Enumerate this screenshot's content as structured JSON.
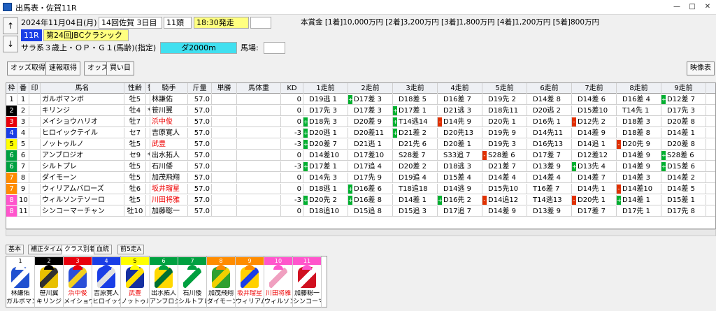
{
  "window": {
    "title": "出馬表・佐賀11R",
    "minimize": "—",
    "maximize": "□",
    "close": "✕"
  },
  "race": {
    "date": "2024年11月04日(月)",
    "kai": "14回佐賀 3日目",
    "heads": "11頭",
    "start": "18:30発走",
    "rnum": "11R",
    "name": "第24回JBCクラシック",
    "cond": "サラ系３歳上・ＯＰ・Ｇ１(馬齢)(指定)",
    "course": "ダ2000m",
    "baba_label": "馬場:",
    "baba": "",
    "prize": "本賞金 [1着]10,000万円 [2着]3,200万円 [3着]1,800万円 [4着]1,200万円 [5着]800万円",
    "up_icon": "↑",
    "down_icon": "↓"
  },
  "toolbar": {
    "odds": "オッズ取得",
    "sokuho": "速報取得",
    "odds2": "オッズ",
    "kaime": "買い目",
    "video": "映像表"
  },
  "columns": [
    "枠",
    "番",
    "印",
    "馬名",
    "性齢",
    "替",
    "騎手",
    "斤量",
    "単勝",
    "馬体重",
    "KD",
    "1走前",
    "2走前",
    "3走前",
    "4走前",
    "5走前",
    "6走前",
    "7走前",
    "8走前",
    "9走前"
  ],
  "colors": {
    "gate1": "#ffffff",
    "gate2": "#000000",
    "gate3": "#e8000c",
    "gate4": "#1a3ee6",
    "gate5": "#ffff00",
    "gate6": "#00a040",
    "gate7": "#ff8c00",
    "gate8": "#ff55cc"
  },
  "rows": [
    {
      "waku": "1",
      "ban": "1",
      "mark": "",
      "name": "ガルボマンボ",
      "sex": "牡5",
      "chg": "",
      "jockey": "林謙佑",
      "jred": false,
      "kin": "57.0",
      "tan": "",
      "wt": "",
      "kd": "0",
      "runs": [
        "D19逃 1",
        "D17差 3",
        "D18差 5",
        "D16差 7",
        "D19先 2",
        "D14差 8",
        "D14差 6",
        "D16差 4",
        "D12差 7"
      ],
      "mk": [
        "",
        "g",
        "",
        "",
        "",
        "",
        "",
        "",
        "g"
      ]
    },
    {
      "waku": "2",
      "ban": "2",
      "mark": "",
      "name": "キリンジ",
      "sex": "牡4",
      "chg": "*",
      "jockey": "笹川翼",
      "jred": false,
      "kin": "57.0",
      "tan": "",
      "wt": "",
      "kd": "0",
      "runs": [
        "D17先 3",
        "D17差 3",
        "D17差 1",
        "D21逃 3",
        "D18先11",
        "D20逃 2",
        "D15差10",
        "T14先 1",
        "D17先 3"
      ],
      "mk": [
        "",
        "",
        "g",
        "",
        "",
        "",
        "",
        "",
        ""
      ]
    },
    {
      "waku": "3",
      "ban": "3",
      "mark": "",
      "name": "メイショウハリオ",
      "sex": "牡7",
      "chg": "",
      "jockey": "浜中俊",
      "jred": true,
      "kin": "57.0",
      "tan": "",
      "wt": "",
      "kd": "0",
      "runs": [
        "D18先 3",
        "D20差 9",
        "T14逃14",
        "D14先 9",
        "D20先 1",
        "D16先 1",
        "D12先 2",
        "D18差 3",
        "D20差 8"
      ],
      "mk": [
        "g",
        "",
        "g",
        "r",
        "",
        "",
        "r",
        "",
        ""
      ]
    },
    {
      "waku": "4",
      "ban": "4",
      "mark": "",
      "name": "ヒロイックテイル",
      "sex": "セ7",
      "chg": "",
      "jockey": "吉原寛人",
      "jred": false,
      "kin": "57.0",
      "tan": "",
      "wt": "",
      "kd": "-3",
      "runs": [
        "D20逃 1",
        "D20差11",
        "D21差 2",
        "D20先13",
        "D19先 9",
        "D14先11",
        "D14差 9",
        "D18差 8",
        "D14差 1"
      ],
      "mk": [
        "g",
        "",
        "g",
        "",
        "",
        "",
        "",
        "",
        ""
      ]
    },
    {
      "waku": "5",
      "ban": "5",
      "mark": "",
      "name": "ノットゥルノ",
      "sex": "牡5",
      "chg": "",
      "jockey": "武豊",
      "jred": true,
      "kin": "57.0",
      "tan": "",
      "wt": "",
      "kd": "-3",
      "runs": [
        "D20差 7",
        "D21逃 1",
        "D21先 6",
        "D20差 1",
        "D19先 3",
        "D16先13",
        "D14追 1",
        "D20先 9",
        "D20差 8"
      ],
      "mk": [
        "g",
        "",
        "",
        "",
        "",
        "",
        "",
        "r",
        ""
      ]
    },
    {
      "waku": "6",
      "ban": "6",
      "mark": "",
      "name": "アンブロジオ",
      "sex": "セ9",
      "chg": "*",
      "jockey": "出水拓人",
      "jred": false,
      "kin": "57.0",
      "tan": "",
      "wt": "",
      "kd": "0",
      "runs": [
        "D14差10",
        "D17差10",
        "S28差 7",
        "S33追 7",
        "S28差 6",
        "D17差 7",
        "D12差12",
        "D14差 9",
        "S28差 6"
      ],
      "mk": [
        "",
        "",
        "",
        "",
        "r",
        "",
        "",
        "",
        "g"
      ]
    },
    {
      "waku": "6",
      "ban": "7",
      "mark": "",
      "name": "シルトプレ",
      "sex": "牡5",
      "chg": "",
      "jockey": "石川倭",
      "jred": false,
      "kin": "57.0",
      "tan": "",
      "wt": "",
      "kd": "-3",
      "runs": [
        "D17差 1",
        "D17追 4",
        "D20差 2",
        "D18逃 3",
        "D21差 7",
        "D13差 9",
        "D13先 4",
        "D14差 9",
        "D15差 6"
      ],
      "mk": [
        "g",
        "",
        "",
        "",
        "",
        "",
        "g",
        "",
        "g"
      ]
    },
    {
      "waku": "7",
      "ban": "8",
      "mark": "",
      "name": "ダイモーン",
      "sex": "牡5",
      "chg": "",
      "jockey": "加茂飛翔",
      "jred": false,
      "kin": "57.0",
      "tan": "",
      "wt": "",
      "kd": "0",
      "runs": [
        "D14先 3",
        "D17先 9",
        "D19追 4",
        "D15差 4",
        "D14差 4",
        "D14差 4",
        "D14差 7",
        "D14差 3",
        "D14差 2"
      ],
      "mk": [
        "",
        "",
        "",
        "",
        "",
        "",
        "",
        "",
        ""
      ]
    },
    {
      "waku": "7",
      "ban": "9",
      "mark": "",
      "name": "ウィリアムバローズ",
      "sex": "牡6",
      "chg": "",
      "jockey": "坂井瑠星",
      "jred": true,
      "kin": "57.0",
      "tan": "",
      "wt": "",
      "kd": "0",
      "runs": [
        "D18逃 1",
        "D16差 6",
        "T18追18",
        "D14逃 9",
        "D15先10",
        "T16差 7",
        "D14先 1",
        "D14差10",
        "D14差 5"
      ],
      "mk": [
        "",
        "g",
        "",
        "",
        "",
        "",
        "",
        "r",
        ""
      ]
    },
    {
      "waku": "8",
      "ban": "10",
      "mark": "",
      "name": "ウィルソンテソーロ",
      "sex": "牡5",
      "chg": "",
      "jockey": "川田将雅",
      "jred": true,
      "kin": "57.0",
      "tan": "",
      "wt": "",
      "kd": "-3",
      "runs": [
        "D20先 2",
        "D16差 8",
        "D14差 1",
        "D16先 2",
        "D14追12",
        "T14逃13",
        "D20先 1",
        "D14差 1",
        "D15差 1"
      ],
      "mk": [
        "g",
        "g",
        "",
        "g",
        "r",
        "",
        "r",
        "g",
        ""
      ]
    },
    {
      "waku": "8",
      "ban": "11",
      "mark": "",
      "name": "シンコーマーチャン",
      "sex": "牡10",
      "chg": "",
      "jockey": "加藤聡一",
      "jred": false,
      "kin": "57.0",
      "tan": "",
      "wt": "",
      "kd": "0",
      "runs": [
        "D18追10",
        "D15追 8",
        "D15追 3",
        "D17追 7",
        "D14差 9",
        "D13差 9",
        "D17差 7",
        "D17先 1",
        "D17先 8"
      ],
      "mk": [
        "",
        "",
        "",
        "",
        "",
        "",
        "",
        "",
        ""
      ]
    }
  ],
  "tabs": [
    "基本",
    "補正タイム",
    "クラス別着",
    "血統",
    "前5走A"
  ],
  "silks": [
    {
      "num": "1",
      "jockey": "林謙佑",
      "horse": "ガルボマンボ",
      "body": "#2050d0",
      "alt": "#ffffff",
      "cap": "#ffffff",
      "nbg": "#ffffff",
      "nfg": "#000000",
      "jred": false
    },
    {
      "num": "2",
      "jockey": "笹川翼",
      "horse": "キリンジ",
      "body": "#e8c000",
      "alt": "#303030",
      "cap": "#000000",
      "nbg": "#000000",
      "nfg": "#ffffff",
      "jred": false
    },
    {
      "num": "3",
      "jockey": "浜中俊",
      "horse": "メイショウハリオ",
      "body": "#2a4fd8",
      "alt": "#f2d020",
      "cap": "#e8000c",
      "nbg": "#e8000c",
      "nfg": "#ffffff",
      "jred": true
    },
    {
      "num": "4",
      "jockey": "吉原寛人",
      "horse": "ヒロイックテイル",
      "body": "#1a3ee6",
      "alt": "#e0e0e0",
      "cap": "#1a3ee6",
      "nbg": "#1a3ee6",
      "nfg": "#ffffff",
      "jred": false
    },
    {
      "num": "5",
      "jockey": "武豊",
      "horse": "ノットゥルノ",
      "body": "#1530a0",
      "alt": "#ffe000",
      "cap": "#ffff00",
      "nbg": "#ffff00",
      "nfg": "#000000",
      "jred": true
    },
    {
      "num": "6",
      "jockey": "出水拓人",
      "horse": "アンブロジオ",
      "body": "#ffd800",
      "alt": "#007030",
      "cap": "#00a040",
      "nbg": "#00a040",
      "nfg": "#ffffff",
      "jred": false
    },
    {
      "num": "7",
      "jockey": "石川倭",
      "horse": "シルトプレ",
      "body": "#ffffff",
      "alt": "#00a040",
      "cap": "#00a040",
      "nbg": "#00a040",
      "nfg": "#ffffff",
      "jred": false
    },
    {
      "num": "8",
      "jockey": "加茂飛翔",
      "horse": "ダイモーン",
      "body": "#30a030",
      "alt": "#f0d000",
      "cap": "#ff8c00",
      "nbg": "#ff8c00",
      "nfg": "#ffffff",
      "jred": false
    },
    {
      "num": "9",
      "jockey": "坂井瑠星",
      "horse": "ウィリアムバローズ",
      "body": "#ffd000",
      "alt": "#1a3ee6",
      "cap": "#ff8c00",
      "nbg": "#ff8c00",
      "nfg": "#ffffff",
      "jred": true
    },
    {
      "num": "10",
      "jockey": "川田将雅",
      "horse": "ウィルソンテソーロ",
      "body": "#ffffff",
      "alt": "#f0a0c0",
      "cap": "#ff55cc",
      "nbg": "#ff55cc",
      "nfg": "#ffffff",
      "jred": true
    },
    {
      "num": "11",
      "jockey": "加藤聡一",
      "horse": "シンコーマーチャン",
      "body": "#d01020",
      "alt": "#ffffff",
      "cap": "#ff55cc",
      "nbg": "#ff55cc",
      "nfg": "#ffffff",
      "jred": false
    }
  ]
}
